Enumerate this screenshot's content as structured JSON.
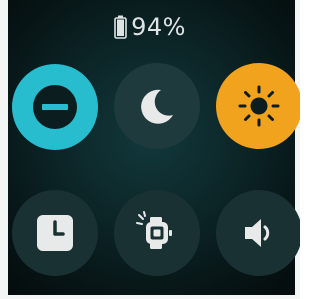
{
  "status": {
    "battery_icon": "battery-icon",
    "battery_text": "94%",
    "battery_level": 0.94
  },
  "quick_settings": [
    {
      "id": "do-not-disturb",
      "icon": "minus-circle-icon",
      "active": true,
      "color": "#28bccf"
    },
    {
      "id": "sleep-mode",
      "icon": "moon-icon",
      "active": false,
      "color": "#1e3a3c"
    },
    {
      "id": "brightness",
      "icon": "sun-icon",
      "active": true,
      "color": "#f2a31e"
    },
    {
      "id": "alarms",
      "icon": "clock-icon",
      "active": false,
      "color": "#1a3133"
    },
    {
      "id": "screen-wake",
      "icon": "watch-wake-icon",
      "active": false,
      "color": "#1a3133"
    },
    {
      "id": "sound",
      "icon": "speaker-icon",
      "active": false,
      "color": "#1a3133"
    }
  ],
  "colors": {
    "background": "#0c2628",
    "accent_cyan": "#28bccf",
    "accent_orange": "#f2a31e",
    "icon_light": "#e8eaea",
    "icon_dark": "#0b1d1f"
  }
}
